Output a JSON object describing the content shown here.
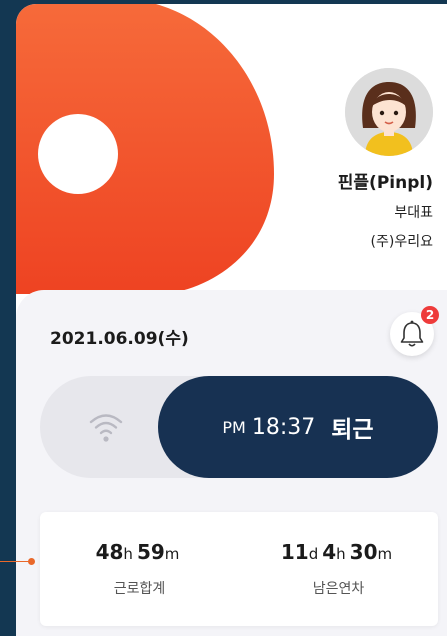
{
  "colors": {
    "brand_orange": "#f15a2e",
    "navy": "#173152",
    "badge_red": "#ee3b3b",
    "background": "#133752"
  },
  "profile": {
    "name": "핀플(Pinpl)",
    "position": "부대표",
    "company": "(주)우리요"
  },
  "header": {
    "date": "2021.06.09(수)",
    "notification_count": "2"
  },
  "attendance": {
    "icon": "wifi-icon",
    "ampm": "PM",
    "time": "18:37",
    "status": "퇴근"
  },
  "stats": {
    "work_total": {
      "h_value": "48",
      "h_unit": "h",
      "m_value": "59",
      "m_unit": "m",
      "label": "근로합계"
    },
    "leave_remaining": {
      "d_value": "11",
      "d_unit": "d",
      "h_value": "4",
      "h_unit": "h",
      "m_value": "30",
      "m_unit": "m",
      "label": "남은연차"
    }
  }
}
